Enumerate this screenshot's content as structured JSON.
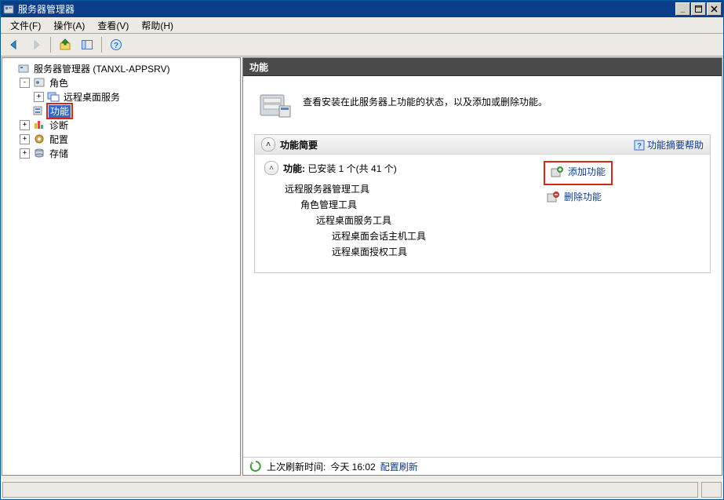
{
  "window": {
    "title": "服务器管理器"
  },
  "menus": {
    "file": "文件(F)",
    "action": "操作(A)",
    "view": "查看(V)",
    "help": "帮助(H)"
  },
  "tree": {
    "root": "服务器管理器 (TANXL-APPSRV)",
    "roles": "角色",
    "rds": "远程桌面服务",
    "features": "功能",
    "diagnostics": "诊断",
    "configuration": "配置",
    "storage": "存储"
  },
  "main": {
    "header": "功能",
    "summary_text": "查看安装在此服务器上功能的状态，以及添加或删除功能。",
    "panel_title": "功能简要",
    "panel_help": "功能摘要帮助",
    "features_label": "功能:",
    "features_value": "已安装 1 个(共 41 个)",
    "installed_root": "远程服务器管理工具",
    "installed_l1": "角色管理工具",
    "installed_l2": "远程桌面服务工具",
    "installed_l3a": "远程桌面会话主机工具",
    "installed_l3b": "远程桌面授权工具",
    "add_feature": "添加功能",
    "remove_feature": "删除功能"
  },
  "status": {
    "prefix": "上次刷新时间:",
    "time": "今天 16:02",
    "link": "配置刷新"
  }
}
